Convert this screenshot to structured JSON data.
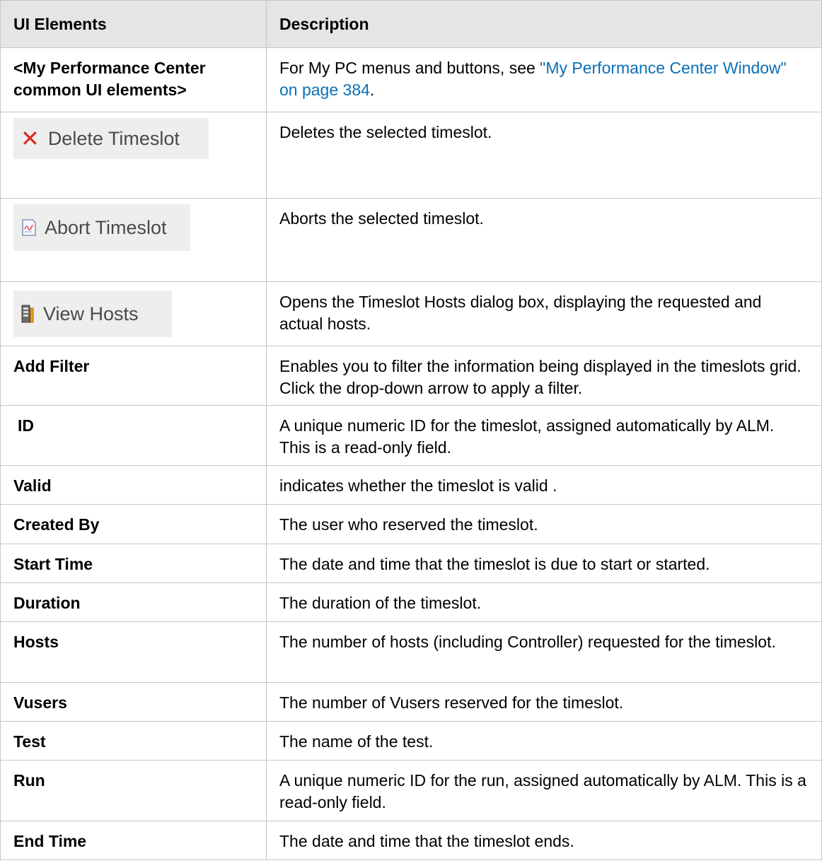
{
  "header": {
    "col1": "UI Elements",
    "col2": "Description"
  },
  "rows": {
    "common": {
      "name": "<My Performance Center common UI elements>",
      "desc_prefix": "For My PC menus and buttons, see ",
      "link_text": "\"My Performance Center Window\" on page 384",
      "desc_suffix": "."
    },
    "delete": {
      "button_label": "Delete Timeslot",
      "icon": "delete-x-icon",
      "desc": "Deletes the selected timeslot."
    },
    "abort": {
      "button_label": "Abort Timeslot",
      "icon": "abort-timeslot-icon",
      "desc": "Aborts the selected timeslot."
    },
    "view_hosts": {
      "button_label": "View Hosts",
      "icon": "hosts-icon",
      "desc": "Opens the Timeslot Hosts dialog box, displaying the requested and actual hosts."
    },
    "add_filter": {
      "name": "Add Filter",
      "desc": "Enables you to filter the information being displayed in the timeslots grid. Click the drop-down arrow to apply a filter."
    },
    "id": {
      "name": "ID",
      "desc": "A unique numeric ID for the timeslot, assigned automatically by ALM. This is a read-only field."
    },
    "valid": {
      "name": "Valid",
      "desc": "indicates whether the timeslot is valid ."
    },
    "created_by": {
      "name": "Created By",
      "desc": "The user who reserved the timeslot."
    },
    "start_time": {
      "name": "Start Time",
      "desc": "The date and time that the timeslot is due to start or started."
    },
    "duration": {
      "name": "Duration",
      "desc": "The duration of the timeslot."
    },
    "hosts": {
      "name": "Hosts",
      "desc": "The number of hosts (including Controller) requested for the timeslot."
    },
    "vusers": {
      "name": "Vusers",
      "desc": "The number of Vusers reserved for the timeslot."
    },
    "test": {
      "name": "Test",
      "desc": "The name of the test."
    },
    "run": {
      "name": "Run",
      "desc": "A unique numeric ID for the run, assigned automatically by ALM. This is a read-only field."
    },
    "end_time": {
      "name": "End Time",
      "desc": "The date and time that the timeslot ends."
    }
  },
  "colors": {
    "header_bg": "#e5e5e5",
    "border": "#c6c6c6",
    "link": "#0b6fb5",
    "delete_icon": "#d92b1f",
    "button_bg": "#eeeeee"
  }
}
